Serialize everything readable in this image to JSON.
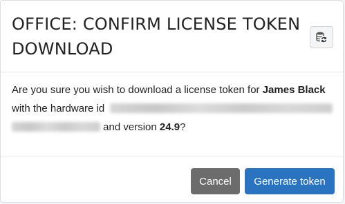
{
  "dialog": {
    "title": "OFFICE: CONFIRM LICENSE TOKEN DOWNLOAD",
    "header_icon": "database-refresh-icon"
  },
  "body": {
    "text_before_name": "Are you sure you wish to download a license token for ",
    "user_name": "James Black",
    "text_before_hwid": "with the hardware id ",
    "hardware_id_redacted": true,
    "text_before_version": " and version ",
    "version": "24.9",
    "text_end": "?"
  },
  "footer": {
    "cancel_label": "Cancel",
    "generate_label": "Generate token"
  },
  "colors": {
    "cancel_bg": "#6c6c6c",
    "generate_bg": "#2a73c0"
  }
}
